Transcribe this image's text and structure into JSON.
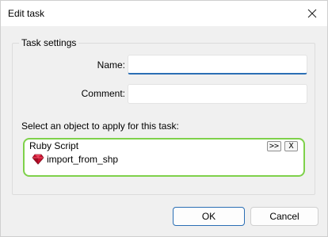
{
  "dialog": {
    "title": "Edit task",
    "close_icon": "close-icon"
  },
  "task_settings": {
    "group_label": "Task settings",
    "name_label": "Name:",
    "name_value": "",
    "comment_label": "Comment:",
    "comment_value": ""
  },
  "object_selector": {
    "prompt": "Select an object to apply for this task:",
    "header": "Ruby Script",
    "expand_button": ">>",
    "remove_button": "X",
    "item": {
      "icon": "ruby-icon",
      "label": "import_from_shp"
    },
    "border_color": "#7ed14a"
  },
  "buttons": {
    "ok": "OK",
    "cancel": "Cancel"
  },
  "colors": {
    "accent": "#2b6fb5"
  }
}
